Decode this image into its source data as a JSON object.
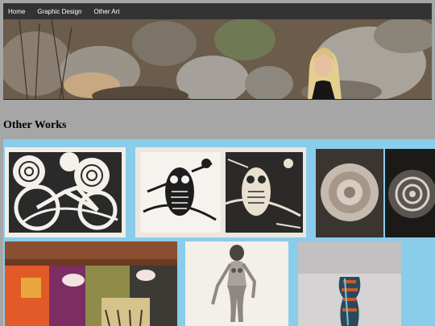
{
  "nav": {
    "items": [
      {
        "label": "Home"
      },
      {
        "label": "Graphic Design"
      },
      {
        "label": "Other Art"
      }
    ]
  },
  "page": {
    "heading": "Other Works"
  },
  "colors": {
    "page_background": "#a6a6a6",
    "navbar": "#333333",
    "gallery_background": "#89cdea"
  }
}
